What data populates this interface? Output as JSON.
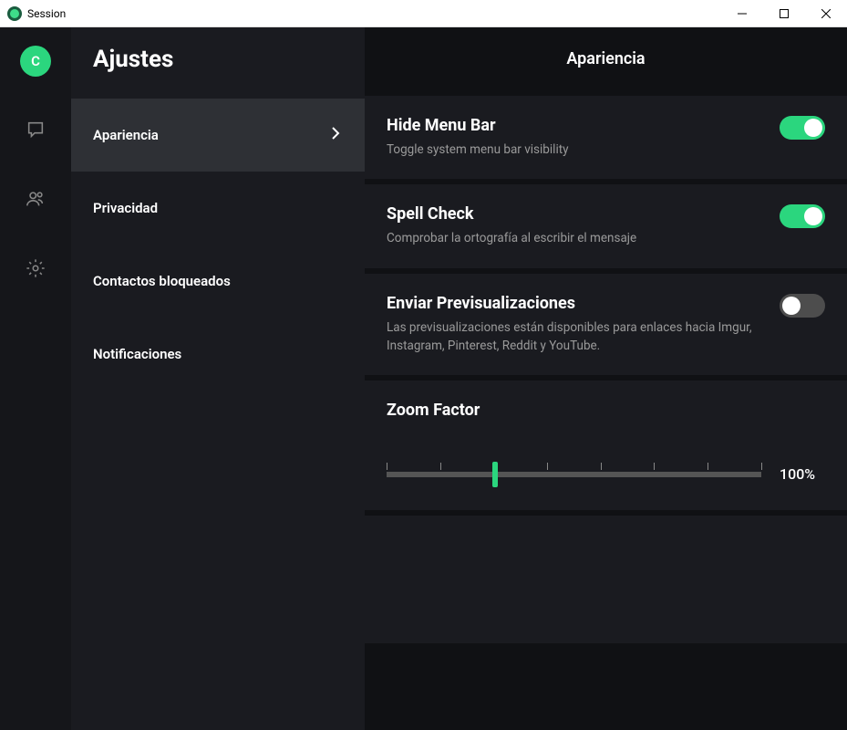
{
  "window": {
    "title": "Session"
  },
  "avatar": {
    "letter": "C"
  },
  "settings": {
    "title": "Ajustes",
    "nav": [
      {
        "id": "appearance",
        "label": "Apariencia",
        "active": true
      },
      {
        "id": "privacy",
        "label": "Privacidad",
        "active": false
      },
      {
        "id": "blocked",
        "label": "Contactos bloqueados",
        "active": false
      },
      {
        "id": "notifications",
        "label": "Notificaciones",
        "active": false
      }
    ]
  },
  "main": {
    "header": "Apariencia",
    "items": [
      {
        "id": "hide-menu-bar",
        "title": "Hide Menu Bar",
        "desc": "Toggle system menu bar visibility",
        "toggle": true
      },
      {
        "id": "spell-check",
        "title": "Spell Check",
        "desc": "Comprobar la ortografía al escribir el mensaje",
        "toggle": true
      },
      {
        "id": "send-previews",
        "title": "Enviar Previsualizaciones",
        "desc": "Las previsualizaciones están disponibles para enlaces hacia Imgur, Instagram, Pinterest, Reddit y YouTube.",
        "toggle": false
      }
    ],
    "zoom": {
      "title": "Zoom Factor",
      "value_label": "100%",
      "value_percent": 29,
      "ticks_percent": [
        0,
        14.3,
        28.6,
        42.9,
        57.1,
        71.4,
        85.7,
        100
      ]
    }
  },
  "colors": {
    "accent": "#2bd67e"
  }
}
